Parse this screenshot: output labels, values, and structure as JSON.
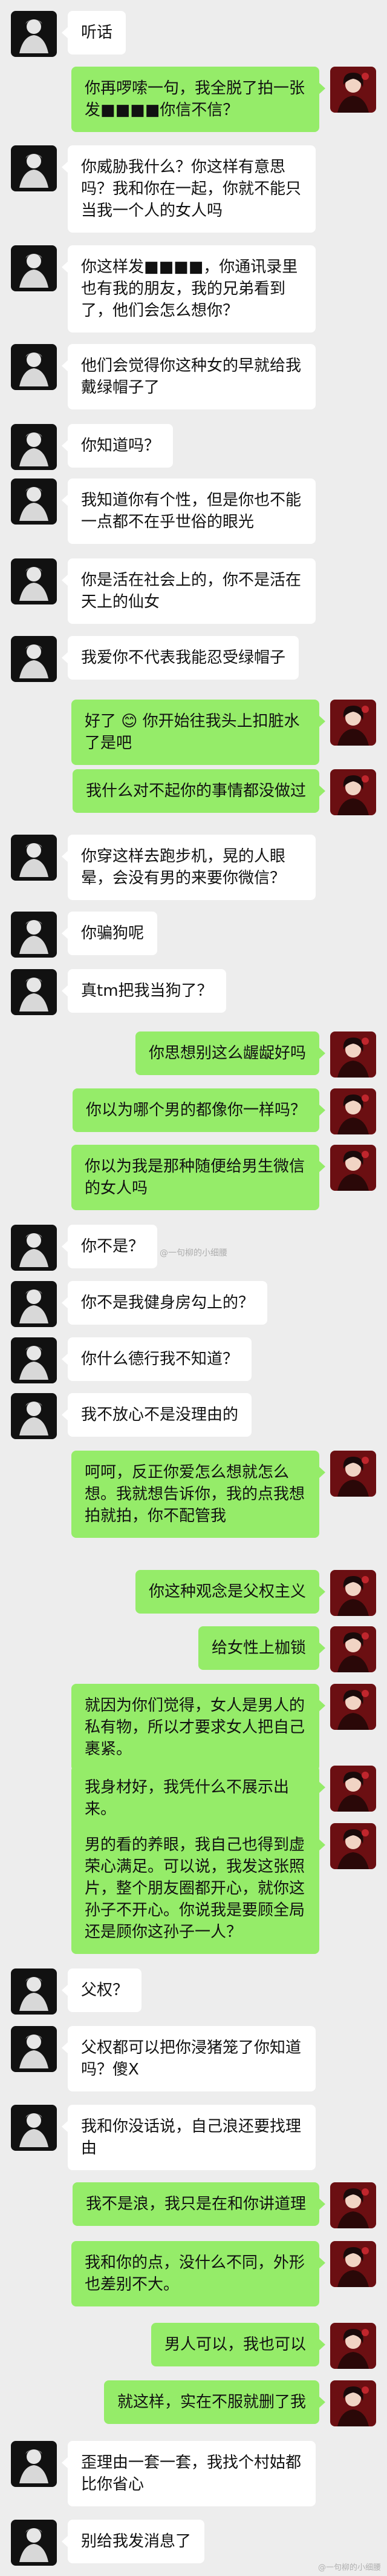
{
  "watermark": "@一句柳的小细腰",
  "watermark_bottom": "@一句柳的小细腰",
  "messages": [
    {
      "side": "in",
      "text": "听话"
    },
    {
      "side": "out",
      "text": "你再啰嗦一句，我全脱了拍一张发■■■■你信不信？"
    },
    {
      "side": "in",
      "text": "你威胁我什么？你这样有意思吗？我和你在一起，你就不能只当我一个人的女人吗"
    },
    {
      "side": "in",
      "text": "你这样发■■■■，你通讯录里也有我的朋友，我的兄弟看到了，他们会怎么想你？"
    },
    {
      "side": "in",
      "text": "他们会觉得你这种女的早就给我戴绿帽子了"
    },
    {
      "side": "in",
      "text": "你知道吗？"
    },
    {
      "side": "in",
      "text": "我知道你有个性，但是你也不能一点都不在乎世俗的眼光"
    },
    {
      "side": "in",
      "text": "你是活在社会上的，你不是活在天上的仙女"
    },
    {
      "side": "in",
      "text": "我爱你不代表我能忍受绿帽子"
    },
    {
      "side": "out",
      "text": "好了 😊 你开始往我头上扣脏水了是吧"
    },
    {
      "side": "out",
      "text": "我什么对不起你的事情都没做过"
    },
    {
      "side": "in",
      "text": "你穿这样去跑步机，晃的人眼晕，会没有男的来要你微信？"
    },
    {
      "side": "in",
      "text": "你骗狗呢"
    },
    {
      "side": "in",
      "text": "真tm把我当狗了？"
    },
    {
      "side": "out",
      "text": "你思想别这么龌龊好吗"
    },
    {
      "side": "out",
      "text": "你以为哪个男的都像你一样吗？"
    },
    {
      "side": "out",
      "text": "你以为我是那种随便给男生微信的女人吗"
    },
    {
      "side": "in",
      "text": "你不是？"
    },
    {
      "side": "in",
      "text": "你不是我健身房勾上的？"
    },
    {
      "side": "in",
      "text": "你什么德行我不知道？"
    },
    {
      "side": "in",
      "text": "我不放心不是没理由的"
    },
    {
      "side": "out",
      "text": "呵呵，反正你爱怎么想就怎么想。我就想告诉你，我的点我想拍就拍，你不配管我"
    },
    {
      "side": "out",
      "text": "你这种观念是父权主义"
    },
    {
      "side": "out",
      "text": "给女性上枷锁"
    },
    {
      "side": "out",
      "text": "就因为你们觉得，女人是男人的私有物，所以才要求女人把自己裹紧。"
    },
    {
      "side": "out",
      "text": "我身材好，我凭什么不展示出来。"
    },
    {
      "side": "out",
      "text": "男的看的养眼，我自己也得到虚荣心满足。可以说，我发这张照片，整个朋友圈都开心，就你这孙子不开心。你说我是要顾全局还是顾你这孙子一人？"
    },
    {
      "side": "in",
      "text": "父权？"
    },
    {
      "side": "in",
      "text": "父权都可以把你浸猪笼了你知道吗？傻X"
    },
    {
      "side": "in",
      "text": "我和你没话说，自己浪还要找理由"
    },
    {
      "side": "out",
      "text": "我不是浪，我只是在和你讲道理"
    },
    {
      "side": "out",
      "text": "我和你的点，没什么不同，外形也差别不大。"
    },
    {
      "side": "out",
      "text": "男人可以，我也可以"
    },
    {
      "side": "out",
      "text": "就这样，实在不服就删了我"
    },
    {
      "side": "in",
      "text": "歪理由一套一套，我找个村姑都比你省心"
    },
    {
      "side": "in",
      "text": "别给我发消息了"
    }
  ]
}
